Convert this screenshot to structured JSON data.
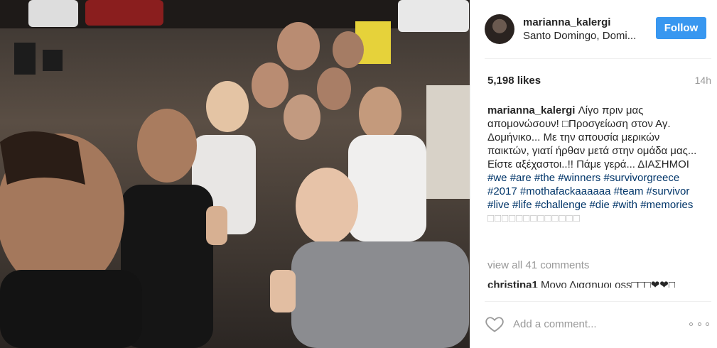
{
  "post": {
    "username": "marianna_kalergi",
    "location": "Santo Domingo, Domi...",
    "follow_label": "Follow",
    "likes": "5,198 likes",
    "time": "14h",
    "caption": {
      "username": "marianna_kalergi",
      "text_line": "Λίγο πριν μας απομονώσουν! □Προσγείωση στον Αγ. Δομήνικο... Με την απουσία μερικών παικτών, γιατί ήρθαν μετά στην ομάδα μας...",
      "text_line2": "Είστε αξέχαστοι..!! Πάμε γερά... ΔΙΑΣΗΜΟΙ",
      "hashtags": [
        "#we",
        "#are",
        "#the",
        "#winners",
        "#survivorgreece",
        "#2017",
        "#mothafackaaaaaa",
        "#team",
        "#survivor",
        "#live",
        "#life",
        "#challenge",
        "#die",
        "#with",
        "#memories"
      ],
      "trailing_boxes": "□□□□□□□□□□□□□"
    },
    "view_all": "view all 41 comments",
    "first_comment": {
      "username": "christina1",
      "text": "Μονο Διασημοι oss□□□❤❤□"
    },
    "add_comment_placeholder": "Add a comment...",
    "icons": {
      "heart": "heart-outline-icon",
      "more": "more-options-icon"
    },
    "colors": {
      "follow_button": "#3897f0",
      "hashtag": "#003569",
      "muted": "#999999"
    }
  }
}
